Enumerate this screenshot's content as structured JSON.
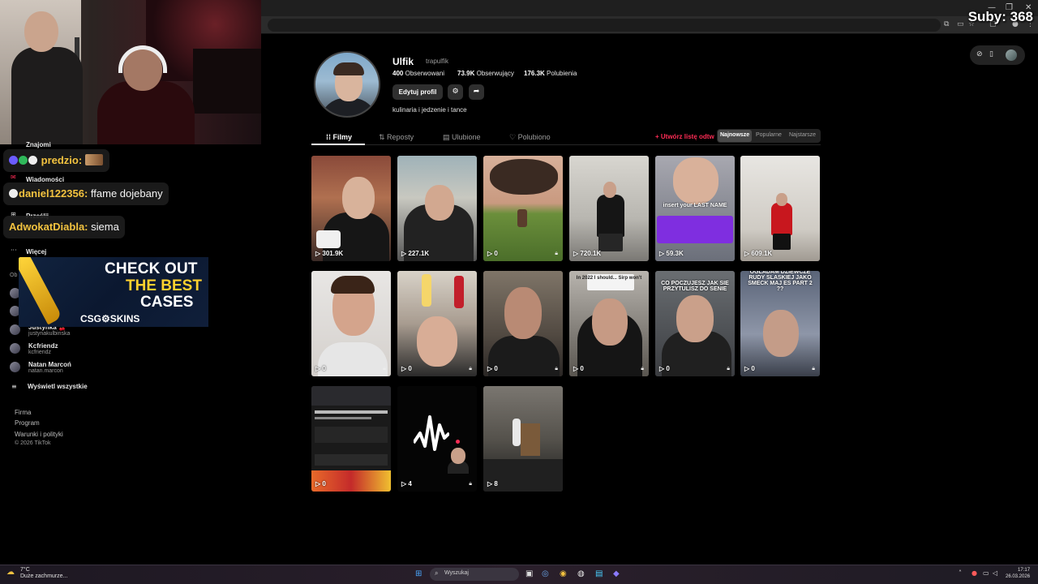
{
  "overlay": {
    "subs_label": "Suby: 368"
  },
  "sidebar": {
    "items": [
      {
        "label": "Znajomi"
      },
      {
        "label": "Wiadomości"
      },
      {
        "label": "Prześlij"
      },
      {
        "label": "Więcej"
      }
    ],
    "obs_heading": "Ob",
    "following": [
      {
        "name": "Justynka 🍒",
        "handle": "justynakulbinska"
      },
      {
        "name": "Kcfriendz",
        "handle": "kcfriendz"
      },
      {
        "name": "Natan Marcoń",
        "handle": "natan.marcon"
      }
    ],
    "show_all": "Wyświetl wszystkie",
    "footer": [
      "Firma",
      "Program",
      "Warunki i polityki",
      "© 2026 TikTok"
    ]
  },
  "chat": [
    {
      "user": "predzio:",
      "message": ""
    },
    {
      "user": "daniel122356:",
      "message": "ffame dojebany"
    },
    {
      "user": "AdwokatDiabla:",
      "message": "siema"
    }
  ],
  "ad": {
    "line1": "CHECK OUT",
    "line2": "THE BEST",
    "line3": "CASES",
    "logo": "CSG⚙SKINS"
  },
  "profile": {
    "username": "Ulfik",
    "handle": "trapulfik",
    "following_count": "400",
    "following_label": "Obserwowani",
    "followers_count": "73.9K",
    "followers_label": "Obserwujący",
    "likes_count": "176.3K",
    "likes_label": "Polubienia",
    "edit_button": "Edytuj profil",
    "bio": "kulinaria i jedzenie i tance"
  },
  "tabs": [
    {
      "label": "Filmy",
      "icon": "grid-icon"
    },
    {
      "label": "Reposty",
      "icon": "repost-icon"
    },
    {
      "label": "Ulubione",
      "icon": "bookmark-icon"
    },
    {
      "label": "Polubiono",
      "icon": "heart-icon"
    }
  ],
  "create_list": "+ Utwórz listę odtw",
  "sort": [
    "Najnowsze",
    "Popularne",
    "Najstarsze"
  ],
  "videos": [
    {
      "views": "301.9K"
    },
    {
      "views": "227.1K"
    },
    {
      "views": "0"
    },
    {
      "views": "720.1K"
    },
    {
      "views": "59.3K",
      "overlay": "insert your LAST NAME"
    },
    {
      "views": "609.1K"
    },
    {
      "views": "0"
    },
    {
      "views": "0"
    },
    {
      "views": "0"
    },
    {
      "views": "0",
      "overlay": "In 2022 I should... Sirp won't"
    },
    {
      "views": "0",
      "overlay": "CO POCZUJESZ JAK SIE PRZYTULISZ DO SENIE"
    },
    {
      "views": "0",
      "overlay": "OGLADAM DZIEWCZE RUDY SLASKIEJ JAKO SMECK MAJ ES PART 2 ??"
    },
    {
      "views": "0"
    },
    {
      "views": "4"
    },
    {
      "views": "8"
    }
  ],
  "taskbar": {
    "weather_temp": "7°C",
    "weather_desc": "Duże zachmurze...",
    "search_placeholder": "Wyszukaj",
    "time": "17:17",
    "date": "26.03.2026"
  }
}
